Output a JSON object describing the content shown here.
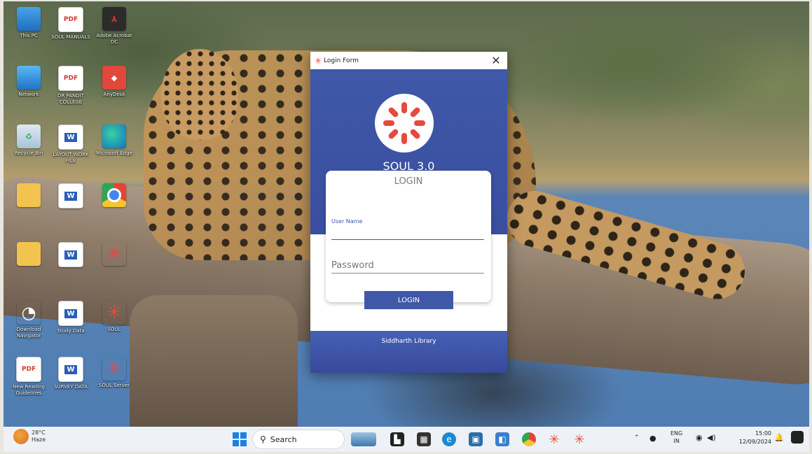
{
  "desktop": {
    "icons": [
      {
        "label": "This PC",
        "glyph": ""
      },
      {
        "label": "SOUL MANUALS",
        "glyph": "PDF"
      },
      {
        "label": "Adobe Acrobat DC",
        "glyph": "⅄"
      },
      {
        "label": "Network",
        "glyph": ""
      },
      {
        "label": "DR PANDIT COLLEGE",
        "glyph": "PDF"
      },
      {
        "label": "AnyDesk",
        "glyph": "◆"
      },
      {
        "label": "Recycle Bin",
        "glyph": "♻"
      },
      {
        "label": "LAYOUT WORK FILE",
        "glyph": "W"
      },
      {
        "label": "Microsoft Edge",
        "glyph": ""
      },
      {
        "label": "",
        "glyph": ""
      },
      {
        "label": "",
        "glyph": "W"
      },
      {
        "label": "",
        "glyph": ""
      },
      {
        "label": "",
        "glyph": ""
      },
      {
        "label": "",
        "glyph": "W"
      },
      {
        "label": "",
        "glyph": "✳"
      },
      {
        "label": "Download Navigator",
        "glyph": "◔"
      },
      {
        "label": "Study Data",
        "glyph": "W"
      },
      {
        "label": "SOUL",
        "glyph": "✳"
      },
      {
        "label": "New Reading Guidelines",
        "glyph": "PDF"
      },
      {
        "label": "SURVEY DATA",
        "glyph": "W"
      },
      {
        "label": "SOUL Server",
        "glyph": "✳"
      }
    ]
  },
  "login_window": {
    "title": "Login Form",
    "close_glyph": "✕",
    "app_name": "SOUL 3.0",
    "card_title": "LOGIN",
    "username_label": "User Name",
    "username_value": "",
    "password_placeholder": "Password",
    "login_button": "LOGIN",
    "footer": "Siddharth Library"
  },
  "taskbar": {
    "weather_temp": "28°C",
    "weather_desc": "Haze",
    "search_placeholder": "Search",
    "tray_lang_top": "ENG",
    "tray_lang_bottom": "IN",
    "time": "15:00",
    "date": "12/09/2024"
  },
  "colors": {
    "brand_blue": "#3f58a8",
    "soul_red": "#e54a3f"
  }
}
